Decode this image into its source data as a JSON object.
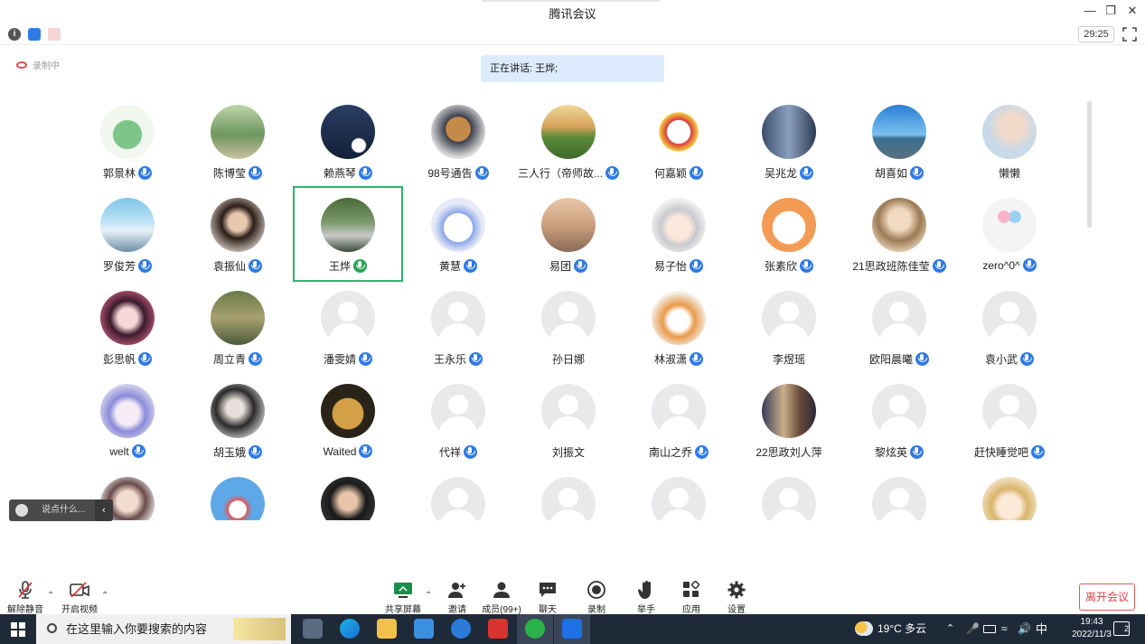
{
  "window": {
    "title": "腾讯会议"
  },
  "infobar": {
    "timer": "29:25"
  },
  "recording": {
    "label": "录制中"
  },
  "speaking": {
    "label": "正在讲话: 王烨;"
  },
  "participants": [
    {
      "name": "郭景林",
      "mic": true,
      "avatar": "dino-green"
    },
    {
      "name": "陈博莹",
      "mic": true,
      "avatar": "park-road"
    },
    {
      "name": "赖燕琴",
      "mic": true,
      "avatar": "night-panda"
    },
    {
      "name": "98号通告",
      "mic": true,
      "avatar": "dog-sofa"
    },
    {
      "name": "三人行（帝师故...",
      "mic": true,
      "avatar": "field-sunset"
    },
    {
      "name": "何嘉颖",
      "mic": true,
      "avatar": "gundam"
    },
    {
      "name": "吴兆龙",
      "mic": true,
      "avatar": "city-towers"
    },
    {
      "name": "胡喜如",
      "mic": true,
      "avatar": "sea-sky"
    },
    {
      "name": "懒懒",
      "mic": false,
      "avatar": "girl-light"
    },
    {
      "name": "罗俊芳",
      "mic": true,
      "avatar": "snow-mountain"
    },
    {
      "name": "袁振仙",
      "mic": true,
      "avatar": "dark-hair"
    },
    {
      "name": "王烨",
      "mic": true,
      "active": true,
      "avatar": "outdoor-person"
    },
    {
      "name": "黄慧",
      "mic": true,
      "avatar": "anime-white"
    },
    {
      "name": "易团",
      "mic": true,
      "avatar": "beach-dusk"
    },
    {
      "name": "易子怡",
      "mic": true,
      "avatar": "anime-grey"
    },
    {
      "name": "张素欣",
      "mic": true,
      "avatar": "puppy-cartoon"
    },
    {
      "name": "21思政班陈佳莹",
      "mic": true,
      "avatar": "girl-warm"
    },
    {
      "name": "zero^0^",
      "mic": true,
      "avatar": "balloons"
    },
    {
      "name": "彭思帆",
      "mic": true,
      "avatar": "anime-girl"
    },
    {
      "name": "周立青",
      "mic": true,
      "avatar": "forest-people"
    },
    {
      "name": "潘雯婧",
      "mic": true,
      "avatar": "default"
    },
    {
      "name": "王永乐",
      "mic": true,
      "avatar": "default"
    },
    {
      "name": "孙日娜",
      "mic": false,
      "avatar": "default"
    },
    {
      "name": "林淑潇",
      "mic": true,
      "avatar": "shiba"
    },
    {
      "name": "李煜瑶",
      "mic": false,
      "avatar": "default"
    },
    {
      "name": "欧阳晨曦",
      "mic": true,
      "avatar": "default"
    },
    {
      "name": "袁小武",
      "mic": true,
      "avatar": "default"
    },
    {
      "name": "welt",
      "mic": true,
      "avatar": "anime-blue"
    },
    {
      "name": "胡玉娥",
      "mic": true,
      "avatar": "girls-bw"
    },
    {
      "name": "Waited",
      "mic": true,
      "avatar": "bear-toy"
    },
    {
      "name": "代祥",
      "mic": true,
      "avatar": "default"
    },
    {
      "name": "刘振文",
      "mic": false,
      "avatar": "default"
    },
    {
      "name": "南山之乔",
      "mic": true,
      "avatar": "default"
    },
    {
      "name": "22思政刘人萍",
      "mic": false,
      "avatar": "group-photo"
    },
    {
      "name": "黎炫英",
      "mic": true,
      "avatar": "default"
    },
    {
      "name": "赶快睡觉吧",
      "mic": true,
      "avatar": "default"
    },
    {
      "name": "",
      "mic": false,
      "avatar": "girl-bed"
    },
    {
      "name": "",
      "mic": false,
      "avatar": "cartoon-blue"
    },
    {
      "name": "",
      "mic": false,
      "avatar": "girl-dark"
    },
    {
      "name": "",
      "mic": false,
      "avatar": "default"
    },
    {
      "name": "",
      "mic": false,
      "avatar": "default"
    },
    {
      "name": "",
      "mic": false,
      "avatar": "default"
    },
    {
      "name": "",
      "mic": false,
      "avatar": "default"
    },
    {
      "name": "",
      "mic": false,
      "avatar": "default"
    },
    {
      "name": "",
      "mic": false,
      "avatar": "anime-blonde"
    }
  ],
  "chat": {
    "placeholder": "说点什么..."
  },
  "toolbar": {
    "unmute": "解除静音",
    "video": "开启视频",
    "share": "共享屏幕",
    "invite": "邀请",
    "members": "成员(99+)",
    "chat": "聊天",
    "record": "录制",
    "raise_hand": "举手",
    "apps": "应用",
    "settings": "设置",
    "leave": "离开会议"
  },
  "taskbar": {
    "search_placeholder": "在这里输入你要搜索的内容",
    "weather": "19°C 多云",
    "ime": "中",
    "time": "19:43",
    "date": "2022/11/3",
    "notifications": "2"
  },
  "colors": {
    "accent": "#2f7ae5",
    "active_border": "#2fb36d",
    "leave_red": "#d9434b",
    "speaking_bg": "#dcebfd"
  }
}
